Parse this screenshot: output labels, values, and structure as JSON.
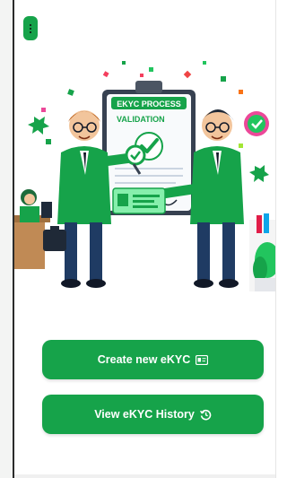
{
  "theme": {
    "accent": "#16a34a",
    "background": "#ffffff"
  },
  "top_bar": {
    "menu_icon": "more-vertical-icon"
  },
  "hero": {
    "board_title": "EKYC PROCESS",
    "board_subtitle": "VALIDATION",
    "illustration": "two-agents-ekyc-validation-illustration"
  },
  "actions": {
    "create_label": "Create new eKYC",
    "create_icon": "id-card-icon",
    "history_label": "View eKYC History",
    "history_icon": "history-icon"
  }
}
